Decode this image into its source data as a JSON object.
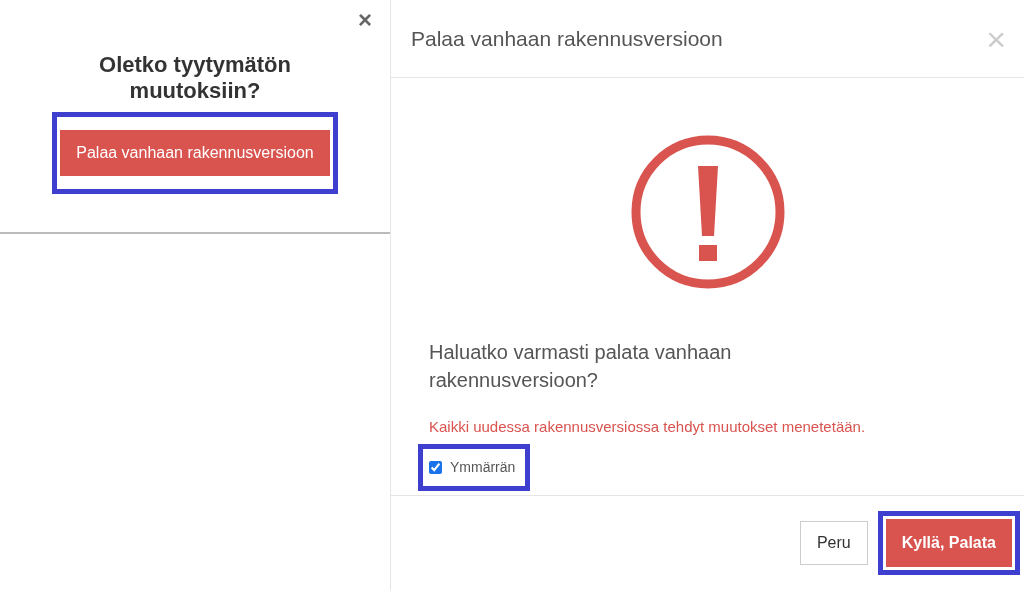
{
  "prompt_panel": {
    "close": "×",
    "heading": "Oletko tyytymätön muutoksiin?",
    "button": {
      "label": "Palaa vanhaan rakennusversioon",
      "highlighted": true
    }
  },
  "dialog": {
    "title": "Palaa vanhaan rakennusversioon",
    "close": "×",
    "question": "Haluatko varmasti palata vanhaan rakennusversioon?",
    "warning": "Kaikki uudessa rakennusversiossa tehdyt muutokset menetetään.",
    "confirm_checkbox": {
      "label": "Ymmärrän",
      "checked": true,
      "highlighted": true
    },
    "buttons": [
      {
        "kind": "secondary",
        "label": "Peru",
        "highlighted": false
      },
      {
        "kind": "danger",
        "label": "Kyllä, Palata",
        "highlighted": true
      }
    ]
  }
}
